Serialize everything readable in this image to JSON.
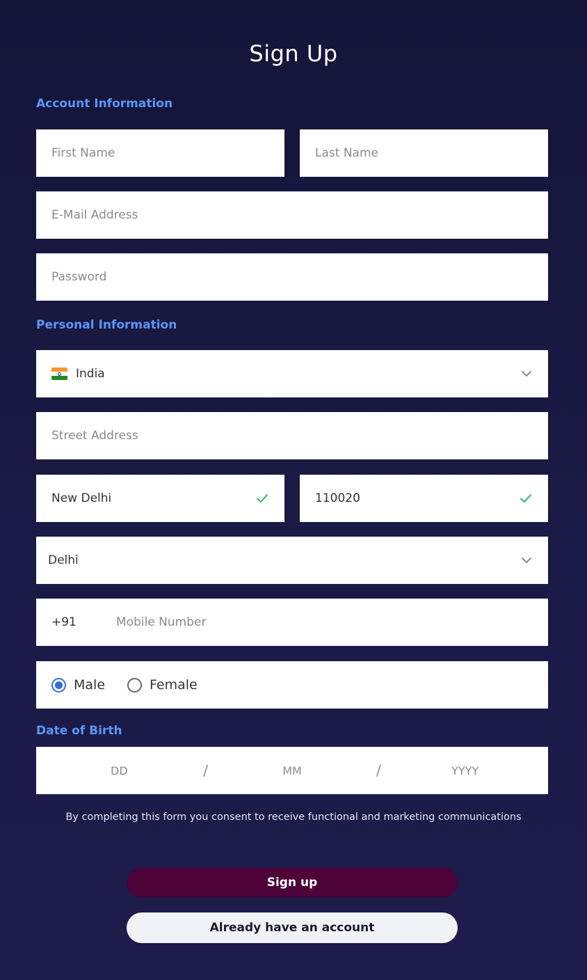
{
  "title": "Sign Up",
  "sections": {
    "account": "Account Information",
    "personal": "Personal Information",
    "dob": "Date of Birth"
  },
  "fields": {
    "first_name": {
      "placeholder": "First Name",
      "value": ""
    },
    "last_name": {
      "placeholder": "Last Name",
      "value": ""
    },
    "email": {
      "placeholder": "E-Mail Address",
      "value": ""
    },
    "password": {
      "placeholder": "Password",
      "value": ""
    },
    "country": {
      "value": "India",
      "flag_icon": "india-flag-icon"
    },
    "street": {
      "placeholder": "Street Address",
      "value": ""
    },
    "city": {
      "value": "New Delhi",
      "valid": true
    },
    "postal_code": {
      "value": "110020",
      "valid": true
    },
    "state": {
      "value": "Delhi"
    },
    "phone_code": "+91",
    "mobile": {
      "placeholder": "Mobile Number",
      "value": ""
    }
  },
  "gender": {
    "options": [
      "Male",
      "Female"
    ],
    "selected": "Male"
  },
  "dob": {
    "day_placeholder": "DD",
    "month_placeholder": "MM",
    "year_placeholder": "YYYY",
    "separator": "/"
  },
  "consent_text": "By completing this form you consent to receive functional and marketing communications",
  "buttons": {
    "signup": "Sign up",
    "have_account": "Already have an account"
  },
  "colors": {
    "background": "#161640",
    "section_label": "#5b97f6",
    "signup_button": "#4d0337",
    "check": "#2eb56b",
    "radio_selected": "#2f6fe0"
  }
}
